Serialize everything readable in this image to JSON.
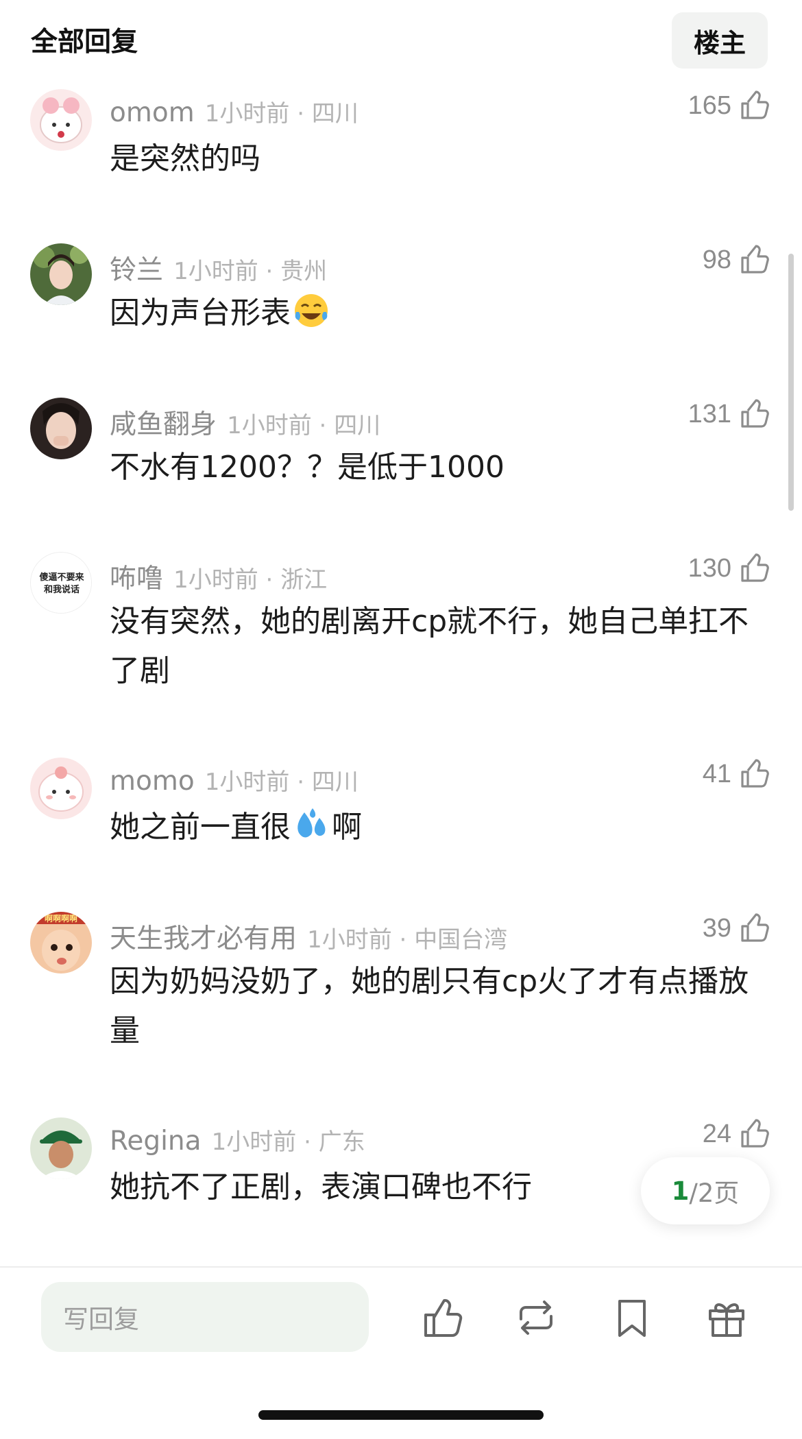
{
  "header": {
    "title": "全部回复",
    "owner_button": "楼主"
  },
  "comments": [
    {
      "username": "omom",
      "time": "1小时前",
      "location": "四川",
      "likes": "165",
      "text_before": "是突然的吗",
      "emoji": "",
      "text_after": ""
    },
    {
      "username": "铃兰",
      "time": "1小时前",
      "location": "贵州",
      "likes": "98",
      "text_before": "因为声台形表",
      "emoji": "tears-of-joy",
      "text_after": ""
    },
    {
      "username": "咸鱼翻身",
      "time": "1小时前",
      "location": "四川",
      "likes": "131",
      "text_before": "不水有1200？？是低于1000",
      "emoji": "",
      "text_after": ""
    },
    {
      "username": "咘噜",
      "time": "1小时前",
      "location": "浙江",
      "likes": "130",
      "text_before": "没有突然，她的剧离开cp就不行，她自己单扛不了剧",
      "emoji": "",
      "text_after": ""
    },
    {
      "username": "momo",
      "time": "1小时前",
      "location": "四川",
      "likes": "41",
      "text_before": "她之前一直很",
      "emoji": "sweat-droplets",
      "text_after": "啊"
    },
    {
      "username": "天生我才必有用",
      "time": "1小时前",
      "location": "中国台湾",
      "likes": "39",
      "text_before": "因为奶妈没奶了，她的剧只有cp火了才有点播放量",
      "emoji": "",
      "text_after": ""
    },
    {
      "username": "Regina",
      "time": "1小时前",
      "location": "广东",
      "likes": "24",
      "text_before": "她抗不了正剧，表演口碑也不行",
      "emoji": "",
      "text_after": ""
    }
  ],
  "avatar_texts": {
    "c4": "傻逼不要来和我说话",
    "c6": "啊啊啊啊"
  },
  "pager": {
    "current": "1",
    "total": "/2页"
  },
  "bottom_bar": {
    "reply_placeholder": "写回复",
    "icons": [
      "thumbs-up-icon",
      "repost-icon",
      "bookmark-icon",
      "gift-icon"
    ]
  },
  "colors": {
    "accent": "#1a8a3a",
    "meta": "#8c8c8c",
    "meta_light": "#b3b3b3",
    "reply_bg": "#eff4ef"
  }
}
